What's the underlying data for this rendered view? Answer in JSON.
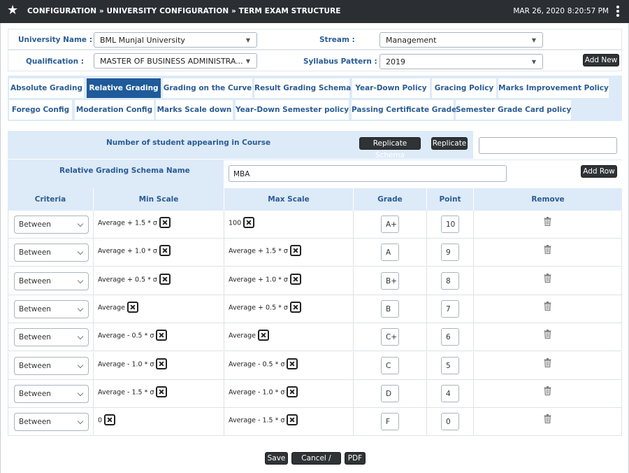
{
  "header": {
    "title": "CONFIGURATION » UNIVERSITY CONFIGURATION » TERM EXAM STRUCTURE",
    "date": "MAR 26, 2020",
    "time": "8:20:57 PM"
  },
  "filters": {
    "university_label": "University Name :",
    "university_value": "BML Munjal University",
    "stream_label": "Stream :",
    "stream_value": "Management",
    "qualification_label": "Qualification :",
    "qualification_value": "MASTER OF BUSINESS ADMINISTRA...",
    "syllabus_label": "Syllabus Pattern :",
    "syllabus_value": "2019",
    "add_new_label": "Add New"
  },
  "tabs": [
    {
      "label": "Absolute Grading"
    },
    {
      "label": "Relative Grading",
      "active": true
    },
    {
      "label": "Grading on the Curve"
    },
    {
      "label": "Result Grading Schema"
    },
    {
      "label": "Year-Down Policy"
    },
    {
      "label": "Gracing Policy"
    },
    {
      "label": "Marks Improvement Policy"
    },
    {
      "label": "Forego Config"
    },
    {
      "label": "Moderation Config"
    },
    {
      "label": "Marks Scale down"
    },
    {
      "label": "Year-Down Semester policy"
    },
    {
      "label": "Passing Certificate Grade"
    },
    {
      "label": "Semester Grade Card policy"
    }
  ],
  "schema": {
    "students_label": "Number of student appearing in Course",
    "replicate_schema_label": "Replicate Schema",
    "replicate_label": "Replicate",
    "students_value": "",
    "name_label": "Relative Grading Schema Name",
    "name_value": "MBA",
    "add_row_label": "Add Row"
  },
  "table": {
    "headers": {
      "criteria": "Criteria",
      "min": "Min Scale",
      "max": "Max Scale",
      "grade": "Grade",
      "point": "Point",
      "remove": "Remove"
    },
    "rows": [
      {
        "criteria": "Between",
        "min": "Average + 1.5 * σ",
        "max": "100",
        "grade": "A+",
        "point": "10"
      },
      {
        "criteria": "Between",
        "min": "Average + 1.0 * σ",
        "max": "Average + 1.5 * σ",
        "grade": "A",
        "point": "9"
      },
      {
        "criteria": "Between",
        "min": "Average + 0.5 * σ",
        "max": "Average + 1.0 * σ",
        "grade": "B+",
        "point": "8"
      },
      {
        "criteria": "Between",
        "min": "Average",
        "max": "Average + 0.5 * σ",
        "grade": "B",
        "point": "7"
      },
      {
        "criteria": "Between",
        "min": "Average - 0.5 * σ",
        "max": "Average",
        "grade": "C+",
        "point": "6"
      },
      {
        "criteria": "Between",
        "min": "Average - 1.0 * σ",
        "max": "Average - 0.5 * σ",
        "grade": "C",
        "point": "5"
      },
      {
        "criteria": "Between",
        "min": "Average - 1.5 * σ",
        "max": "Average - 1.0 * σ",
        "grade": "D",
        "point": "4"
      },
      {
        "criteria": "Between",
        "min": "0",
        "max": "Average - 1.5 * σ",
        "grade": "F",
        "point": "0"
      }
    ]
  },
  "footer": {
    "save_label": "Save",
    "cancel_label": "Cancel / Back",
    "pdf_label": "PDF"
  },
  "colors": {
    "header_bg": "#2b2f33",
    "accent_blue": "#1f5a9a",
    "panel_bg": "#ddeaf8",
    "label_blue": "#2a5c96"
  }
}
